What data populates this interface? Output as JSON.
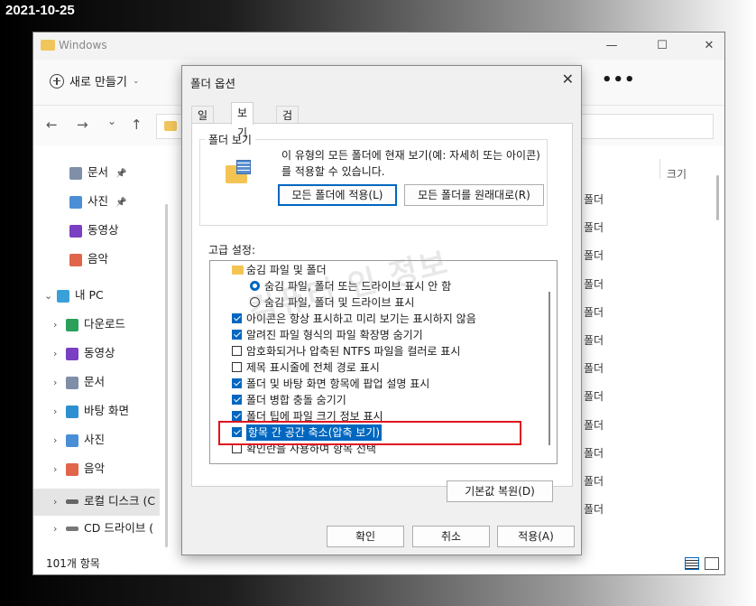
{
  "date_stamp": "2021-10-25",
  "explorer": {
    "title": "Windows",
    "new_button": "새로 만들기",
    "more": "•••",
    "nav": {
      "back": "←",
      "forward": "→",
      "dropdown": "⌄",
      "up": "↑"
    },
    "nav_items": [
      {
        "label": "문서",
        "pinned": true,
        "icon": "documents-icon"
      },
      {
        "label": "사진",
        "pinned": true,
        "icon": "pictures-icon"
      },
      {
        "label": "동영상",
        "pinned": false,
        "icon": "videos-icon"
      },
      {
        "label": "음악",
        "pinned": false,
        "icon": "music-icon"
      },
      {
        "label": "내 PC",
        "pinned": false,
        "icon": "pc-icon"
      },
      {
        "label": "다운로드",
        "pinned": false,
        "icon": "downloads-icon"
      },
      {
        "label": "동영상",
        "pinned": false,
        "icon": "videos-icon"
      },
      {
        "label": "문서",
        "pinned": false,
        "icon": "documents-icon"
      },
      {
        "label": "바탕 화면",
        "pinned": false,
        "icon": "desktop-icon"
      },
      {
        "label": "사진",
        "pinned": false,
        "icon": "pictures-icon"
      },
      {
        "label": "음악",
        "pinned": false,
        "icon": "music-icon"
      },
      {
        "label": "로컬 디스크 (C",
        "pinned": false,
        "icon": "drive-icon"
      },
      {
        "label": "CD 드라이브 (",
        "pinned": false,
        "icon": "cd-drive-icon"
      }
    ],
    "column_header": "크기",
    "file_rows": [
      "폴더",
      "폴더",
      "폴더",
      "폴더",
      "폴더",
      "폴더",
      "폴더",
      "폴더",
      "폴더",
      "폴더",
      "폴더",
      "폴더"
    ],
    "status": "101개 항목"
  },
  "dialog": {
    "title": "폴더 옵션",
    "tabs": [
      "일반",
      "보기",
      "검색"
    ],
    "active_tab": "보기",
    "folder_view": {
      "label": "폴더 보기",
      "description": "이 유형의 모든 폴더에 현재 보기(예: 자세히 또는 아이콘)를 적용할 수 있습니다.",
      "apply_button": "모든 폴더에 적용(L)",
      "reset_button": "모든 폴더를 원래대로(R)"
    },
    "advanced_label": "고급 설정:",
    "settings": [
      {
        "type": "folder",
        "label": "숨김 파일 및 폴더",
        "indent": 0
      },
      {
        "type": "radio",
        "checked": true,
        "label": "숨김 파일, 폴더 또는 드라이브 표시 안 함",
        "indent": 1
      },
      {
        "type": "radio",
        "checked": false,
        "label": "숨김 파일, 폴더 및 드라이브 표시",
        "indent": 1
      },
      {
        "type": "checkbox",
        "checked": true,
        "label": "아이콘은 항상 표시하고 미리 보기는 표시하지 않음",
        "indent": 0
      },
      {
        "type": "checkbox",
        "checked": true,
        "label": "알려진 파일 형식의 파일 확장명 숨기기",
        "indent": 0
      },
      {
        "type": "checkbox",
        "checked": false,
        "label": "암호화되거나 압축된 NTFS 파일을 컬러로 표시",
        "indent": 0
      },
      {
        "type": "checkbox",
        "checked": false,
        "label": "제목 표시줄에 전체 경로 표시",
        "indent": 0
      },
      {
        "type": "checkbox",
        "checked": true,
        "label": "폴더 및 바탕 화면 항목에 팝업 설명 표시",
        "indent": 0
      },
      {
        "type": "checkbox",
        "checked": true,
        "label": "폴더 병합 충돌 숨기기",
        "indent": 0
      },
      {
        "type": "checkbox",
        "checked": true,
        "label": "폴더 팁에 파일 크기 정보 표시",
        "indent": 0
      },
      {
        "type": "checkbox",
        "checked": true,
        "label": "항목 간 공간 축소(압축 보기)",
        "indent": 0,
        "highlighted": true
      },
      {
        "type": "checkbox",
        "checked": false,
        "label": "확인란을 사용하여 항목 선택",
        "indent": 0
      }
    ],
    "restore_button": "기본값 복원(D)",
    "ok_button": "확인",
    "cancel_button": "취소",
    "apply_button": "적용(A)",
    "close_glyph": "✕"
  },
  "watermark": "컴퓨터 인 정보",
  "colors": {
    "accent": "#0067c0",
    "highlight_box": "#e0141e"
  }
}
